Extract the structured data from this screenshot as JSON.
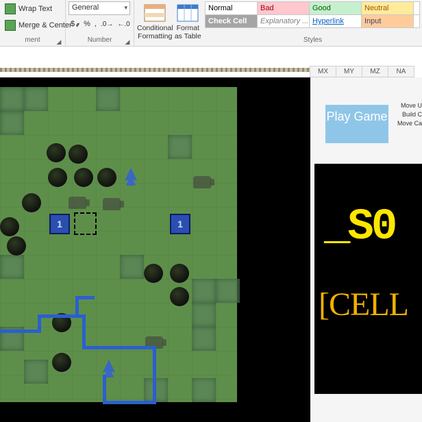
{
  "ribbon": {
    "alignment": {
      "wrap_text": "Wrap Text",
      "merge_center": "Merge & Center",
      "group_label": "ment"
    },
    "number": {
      "format_combo": "General",
      "group_label": "Number",
      "percent": "%",
      "comma": ","
    },
    "tables": {
      "cond_fmt": "Conditional Formatting",
      "fmt_table": "Format as Table"
    },
    "styles": {
      "group_label": "Styles",
      "normal": "Normal",
      "bad": "Bad",
      "good": "Good",
      "neutral": "Neutral",
      "check": "Check Cell",
      "explan": "Explanatory ...",
      "hyper": "Hyperlink",
      "input": "Input"
    }
  },
  "columns": [
    "MX",
    "MY",
    "MZ",
    "NA"
  ],
  "side": {
    "play": "Play Game",
    "cmds": [
      "Move U",
      "Build C",
      "Move Ca"
    ]
  },
  "logo": {
    "line1": "_S0",
    "line2": "[CELL"
  },
  "flags": {
    "val": "1"
  }
}
